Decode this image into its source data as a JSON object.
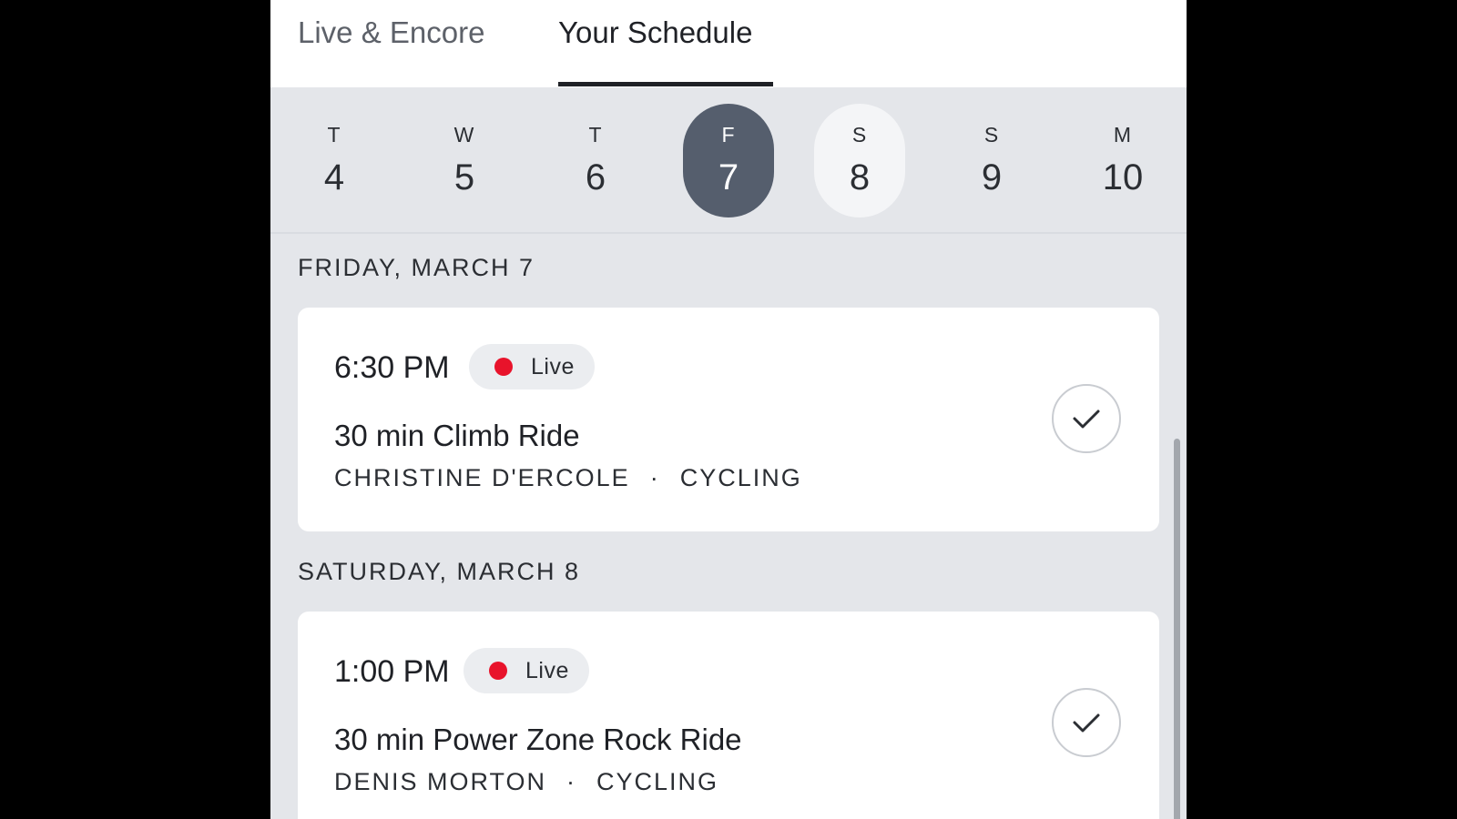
{
  "tabs": [
    {
      "label": "Live & Encore",
      "active": false
    },
    {
      "label": "Your Schedule",
      "active": true
    }
  ],
  "days": [
    {
      "dow": "T",
      "num": "4",
      "state": "normal"
    },
    {
      "dow": "W",
      "num": "5",
      "state": "normal"
    },
    {
      "dow": "T",
      "num": "6",
      "state": "normal"
    },
    {
      "dow": "F",
      "num": "7",
      "state": "selected"
    },
    {
      "dow": "S",
      "num": "8",
      "state": "highlighted"
    },
    {
      "dow": "S",
      "num": "9",
      "state": "normal"
    },
    {
      "dow": "M",
      "num": "10",
      "state": "normal"
    }
  ],
  "sections": [
    {
      "heading": "FRIDAY, MARCH 7",
      "card": {
        "time": "6:30 PM",
        "badge": "Live",
        "title": "30 min Climb Ride",
        "instructor": "CHRISTINE D'ERCOLE",
        "separator": "·",
        "discipline": "CYCLING",
        "booked": true
      }
    },
    {
      "heading": "SATURDAY, MARCH 8",
      "card": {
        "time": "1:00 PM",
        "badge": "Live",
        "title": "30 min Power Zone Rock Ride",
        "instructor": "DENIS MORTON",
        "separator": "·",
        "discipline": "CYCLING",
        "booked": true
      }
    }
  ],
  "colors": {
    "live_dot": "#e8132b",
    "selected_day_bg": "#555e6d",
    "highlighted_day_bg": "#f4f5f7",
    "page_bg": "#e4e6ea"
  },
  "icons": {
    "booked": "checkmark-icon",
    "live": "live-dot-icon"
  }
}
